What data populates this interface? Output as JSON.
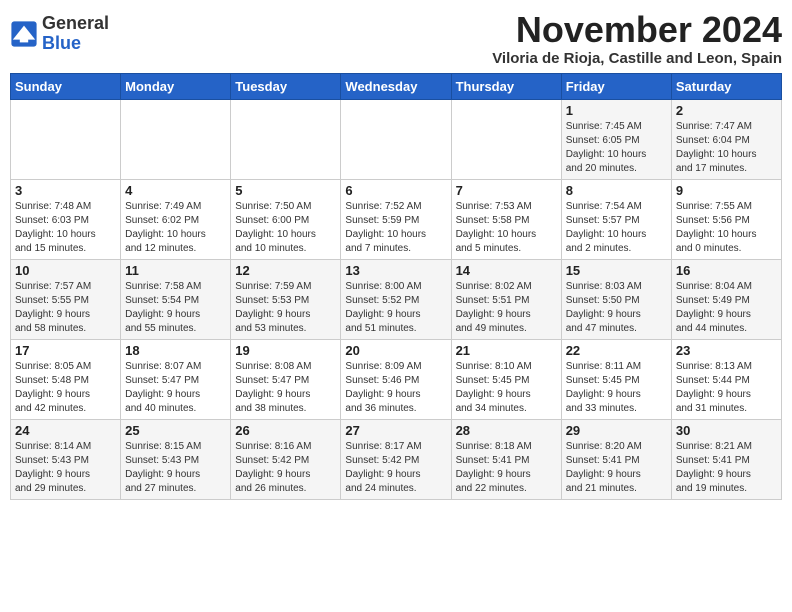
{
  "logo": {
    "general": "General",
    "blue": "Blue"
  },
  "header": {
    "month": "November 2024",
    "location": "Viloria de Rioja, Castille and Leon, Spain"
  },
  "weekdays": [
    "Sunday",
    "Monday",
    "Tuesday",
    "Wednesday",
    "Thursday",
    "Friday",
    "Saturday"
  ],
  "weeks": [
    [
      {
        "day": "",
        "info": ""
      },
      {
        "day": "",
        "info": ""
      },
      {
        "day": "",
        "info": ""
      },
      {
        "day": "",
        "info": ""
      },
      {
        "day": "",
        "info": ""
      },
      {
        "day": "1",
        "info": "Sunrise: 7:45 AM\nSunset: 6:05 PM\nDaylight: 10 hours\nand 20 minutes."
      },
      {
        "day": "2",
        "info": "Sunrise: 7:47 AM\nSunset: 6:04 PM\nDaylight: 10 hours\nand 17 minutes."
      }
    ],
    [
      {
        "day": "3",
        "info": "Sunrise: 7:48 AM\nSunset: 6:03 PM\nDaylight: 10 hours\nand 15 minutes."
      },
      {
        "day": "4",
        "info": "Sunrise: 7:49 AM\nSunset: 6:02 PM\nDaylight: 10 hours\nand 12 minutes."
      },
      {
        "day": "5",
        "info": "Sunrise: 7:50 AM\nSunset: 6:00 PM\nDaylight: 10 hours\nand 10 minutes."
      },
      {
        "day": "6",
        "info": "Sunrise: 7:52 AM\nSunset: 5:59 PM\nDaylight: 10 hours\nand 7 minutes."
      },
      {
        "day": "7",
        "info": "Sunrise: 7:53 AM\nSunset: 5:58 PM\nDaylight: 10 hours\nand 5 minutes."
      },
      {
        "day": "8",
        "info": "Sunrise: 7:54 AM\nSunset: 5:57 PM\nDaylight: 10 hours\nand 2 minutes."
      },
      {
        "day": "9",
        "info": "Sunrise: 7:55 AM\nSunset: 5:56 PM\nDaylight: 10 hours\nand 0 minutes."
      }
    ],
    [
      {
        "day": "10",
        "info": "Sunrise: 7:57 AM\nSunset: 5:55 PM\nDaylight: 9 hours\nand 58 minutes."
      },
      {
        "day": "11",
        "info": "Sunrise: 7:58 AM\nSunset: 5:54 PM\nDaylight: 9 hours\nand 55 minutes."
      },
      {
        "day": "12",
        "info": "Sunrise: 7:59 AM\nSunset: 5:53 PM\nDaylight: 9 hours\nand 53 minutes."
      },
      {
        "day": "13",
        "info": "Sunrise: 8:00 AM\nSunset: 5:52 PM\nDaylight: 9 hours\nand 51 minutes."
      },
      {
        "day": "14",
        "info": "Sunrise: 8:02 AM\nSunset: 5:51 PM\nDaylight: 9 hours\nand 49 minutes."
      },
      {
        "day": "15",
        "info": "Sunrise: 8:03 AM\nSunset: 5:50 PM\nDaylight: 9 hours\nand 47 minutes."
      },
      {
        "day": "16",
        "info": "Sunrise: 8:04 AM\nSunset: 5:49 PM\nDaylight: 9 hours\nand 44 minutes."
      }
    ],
    [
      {
        "day": "17",
        "info": "Sunrise: 8:05 AM\nSunset: 5:48 PM\nDaylight: 9 hours\nand 42 minutes."
      },
      {
        "day": "18",
        "info": "Sunrise: 8:07 AM\nSunset: 5:47 PM\nDaylight: 9 hours\nand 40 minutes."
      },
      {
        "day": "19",
        "info": "Sunrise: 8:08 AM\nSunset: 5:47 PM\nDaylight: 9 hours\nand 38 minutes."
      },
      {
        "day": "20",
        "info": "Sunrise: 8:09 AM\nSunset: 5:46 PM\nDaylight: 9 hours\nand 36 minutes."
      },
      {
        "day": "21",
        "info": "Sunrise: 8:10 AM\nSunset: 5:45 PM\nDaylight: 9 hours\nand 34 minutes."
      },
      {
        "day": "22",
        "info": "Sunrise: 8:11 AM\nSunset: 5:45 PM\nDaylight: 9 hours\nand 33 minutes."
      },
      {
        "day": "23",
        "info": "Sunrise: 8:13 AM\nSunset: 5:44 PM\nDaylight: 9 hours\nand 31 minutes."
      }
    ],
    [
      {
        "day": "24",
        "info": "Sunrise: 8:14 AM\nSunset: 5:43 PM\nDaylight: 9 hours\nand 29 minutes."
      },
      {
        "day": "25",
        "info": "Sunrise: 8:15 AM\nSunset: 5:43 PM\nDaylight: 9 hours\nand 27 minutes."
      },
      {
        "day": "26",
        "info": "Sunrise: 8:16 AM\nSunset: 5:42 PM\nDaylight: 9 hours\nand 26 minutes."
      },
      {
        "day": "27",
        "info": "Sunrise: 8:17 AM\nSunset: 5:42 PM\nDaylight: 9 hours\nand 24 minutes."
      },
      {
        "day": "28",
        "info": "Sunrise: 8:18 AM\nSunset: 5:41 PM\nDaylight: 9 hours\nand 22 minutes."
      },
      {
        "day": "29",
        "info": "Sunrise: 8:20 AM\nSunset: 5:41 PM\nDaylight: 9 hours\nand 21 minutes."
      },
      {
        "day": "30",
        "info": "Sunrise: 8:21 AM\nSunset: 5:41 PM\nDaylight: 9 hours\nand 19 minutes."
      }
    ]
  ]
}
